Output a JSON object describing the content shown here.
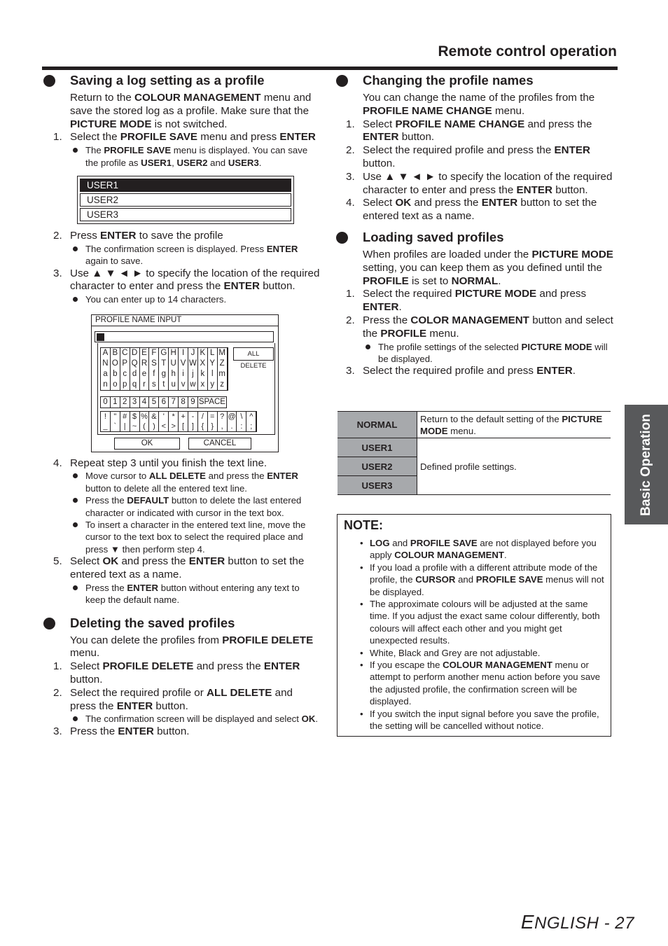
{
  "header": {
    "title": "Remote control operation"
  },
  "side_tab": {
    "label": "Basic Operation"
  },
  "footer": {
    "first_letter": "E",
    "rest": "NGLISH - 27"
  },
  "left": {
    "saving": {
      "title": "Saving a log setting as a profile",
      "intro": [
        "Return to the ",
        "COLOUR MANAGEMENT",
        " menu and save the stored log as a profile. Make sure that the ",
        "PICTURE MODE",
        " is not switched."
      ],
      "step1": [
        "Select the ",
        "PROFILE SAVE",
        " menu and press ",
        "ENTER"
      ],
      "step1_bullet": [
        "The ",
        "PROFILE SAVE",
        " menu is displayed. You can save the profile as ",
        "USER1",
        ", ",
        "USER2",
        " and ",
        "USER3",
        "."
      ],
      "user_list": [
        "USER1",
        "USER2",
        "USER3"
      ],
      "step2": [
        "Press ",
        "ENTER",
        " to save the profile"
      ],
      "step2_bullet": [
        "The confirmation screen is displayed. Press ",
        "ENTER",
        " again to save."
      ],
      "step3": [
        "Use ▲ ▼ ◄ ► to specify the location of the required character to enter and press the ",
        "ENTER",
        " button."
      ],
      "step3_bullet": "You can enter up to 14 characters.",
      "step4": "Repeat step 3 until you finish the text line.",
      "step4_bullets": [
        [
          "Move cursor to ",
          "ALL DELETE",
          " and press the ",
          "ENTER",
          " button to delete all the entered text line."
        ],
        [
          "Press the ",
          "DEFAULT",
          " button to delete the last entered character or indicated with cursor in the text box.",
          "",
          ""
        ],
        [
          "To insert a character in the entered text line, move the cursor to the text box to select the required place and press ▼ then perform step 4.",
          "",
          "",
          "",
          ""
        ]
      ],
      "step5": [
        "Select ",
        "OK",
        " and press the ",
        "ENTER",
        " button to set the entered text as a name."
      ],
      "step5_bullet": [
        "Press the ",
        "ENTER",
        " button without entering any text to keep the default name."
      ]
    },
    "pni": {
      "title": "PROFILE NAME INPUT",
      "rows": [
        [
          "A",
          "B",
          "C",
          "D",
          "E",
          "F",
          "G",
          "H",
          "I",
          "J",
          "K",
          "L",
          "M"
        ],
        [
          "N",
          "O",
          "P",
          "Q",
          "R",
          "S",
          "T",
          "U",
          "V",
          "W",
          "X",
          "Y",
          "Z"
        ],
        [
          "a",
          "b",
          "c",
          "d",
          "e",
          "f",
          "g",
          "h",
          "i",
          "j",
          "k",
          "l",
          "m"
        ],
        [
          "n",
          "o",
          "p",
          "q",
          "r",
          "s",
          "t",
          "u",
          "v",
          "w",
          "x",
          "y",
          "z"
        ]
      ],
      "digits": [
        "0",
        "1",
        "2",
        "3",
        "4",
        "5",
        "6",
        "7",
        "8",
        "9"
      ],
      "space": "SPACE",
      "symbols": [
        [
          "!",
          "\"",
          "#",
          "$",
          "%",
          "&",
          "'",
          "*",
          "+",
          "-",
          "/",
          "=",
          "?",
          "@",
          "\\",
          "^"
        ],
        [
          "_",
          "`",
          "|",
          "~",
          "(",
          ")",
          "<",
          ">",
          "[",
          "]",
          "{",
          "}",
          ",",
          ".",
          ":",
          ";"
        ]
      ],
      "all_delete": "ALL DELETE",
      "ok": "OK",
      "cancel": "CANCEL"
    },
    "deleting": {
      "title": "Deleting the saved profiles",
      "intro": [
        "You can delete the profiles from ",
        "PROFILE DELETE",
        " menu."
      ],
      "step1": [
        "Select ",
        "PROFILE DELETE",
        " and press the ",
        "ENTER",
        " button."
      ],
      "step2": [
        "Select the required profile or ",
        "ALL DELETE",
        " and press the ",
        "ENTER",
        " button."
      ],
      "step2_bullet": [
        "The confirmation screen will be displayed and select ",
        "OK",
        "."
      ],
      "step3": [
        "Press the ",
        "ENTER",
        " button."
      ]
    }
  },
  "right": {
    "changing": {
      "title": "Changing the profile names",
      "intro": [
        "You can change the name of the profiles from the ",
        "PROFILE NAME CHANGE",
        " menu."
      ],
      "step1": [
        "Select ",
        "PROFILE NAME CHANGE",
        " and press the ",
        "ENTER",
        " button."
      ],
      "step2": [
        "Select the required profile and press the ",
        "ENTER",
        " button."
      ],
      "step3": [
        "Use ▲ ▼ ◄ ► to specify the location of the required character to enter and press the ",
        "ENTER",
        " button."
      ],
      "step4": [
        "Select ",
        "OK",
        " and press the ",
        "ENTER",
        " button to set the entered text as a name."
      ]
    },
    "loading": {
      "title": "Loading saved profiles",
      "intro": [
        "When profiles are loaded under the ",
        "PICTURE MODE",
        " setting, you can keep them as you defined until the ",
        "PROFILE",
        " is set to ",
        "NORMAL",
        "."
      ],
      "step1": [
        "Select the required ",
        "PICTURE MODE",
        " and press ",
        "ENTER",
        "."
      ],
      "step2": [
        "Press the ",
        "COLOR MANAGEMENT",
        " button and select the ",
        "PROFILE",
        " menu."
      ],
      "step2_bullet": [
        "The profile settings of the selected ",
        "PICTURE MODE",
        " will be displayed."
      ],
      "step3": [
        "Select the required profile and press ",
        "ENTER",
        "."
      ]
    },
    "table": {
      "rows": [
        {
          "key": "NORMAL",
          "value": [
            "Return to the default setting of the ",
            "PICTURE MODE",
            " menu."
          ]
        },
        {
          "key": "USER1"
        },
        {
          "key": "USER2"
        },
        {
          "key": "USER3"
        }
      ],
      "shared_value": "Defined profile settings."
    },
    "note": {
      "title": "NOTE:",
      "items": [
        [
          "",
          "LOG",
          " and ",
          "PROFILE SAVE",
          " are not displayed before you apply ",
          "COLOUR MANAGEMENT",
          "."
        ],
        [
          "If you load a profile with a different attribute mode of the profile, the ",
          "CURSOR",
          " and ",
          "PROFILE SAVE",
          " menus will not be displayed.",
          "",
          ""
        ],
        [
          "The approximate colours will be adjusted at the same time. If you adjust the exact same colour differently, both colours will affect each other and you might get unexpected results.",
          "",
          "",
          "",
          "",
          "",
          ""
        ],
        [
          "White, Black and Grey are not adjustable.",
          "",
          "",
          "",
          "",
          "",
          ""
        ],
        [
          "If you escape the ",
          "COLOUR MANAGEMENT",
          " menu or attempt to perform another menu action before you save the adjusted profile, the confirmation screen will be displayed.",
          "",
          "",
          "",
          ""
        ],
        [
          "If you switch the input signal before you save the profile, the setting will be cancelled without notice.",
          "",
          "",
          "",
          "",
          "",
          ""
        ]
      ]
    }
  }
}
